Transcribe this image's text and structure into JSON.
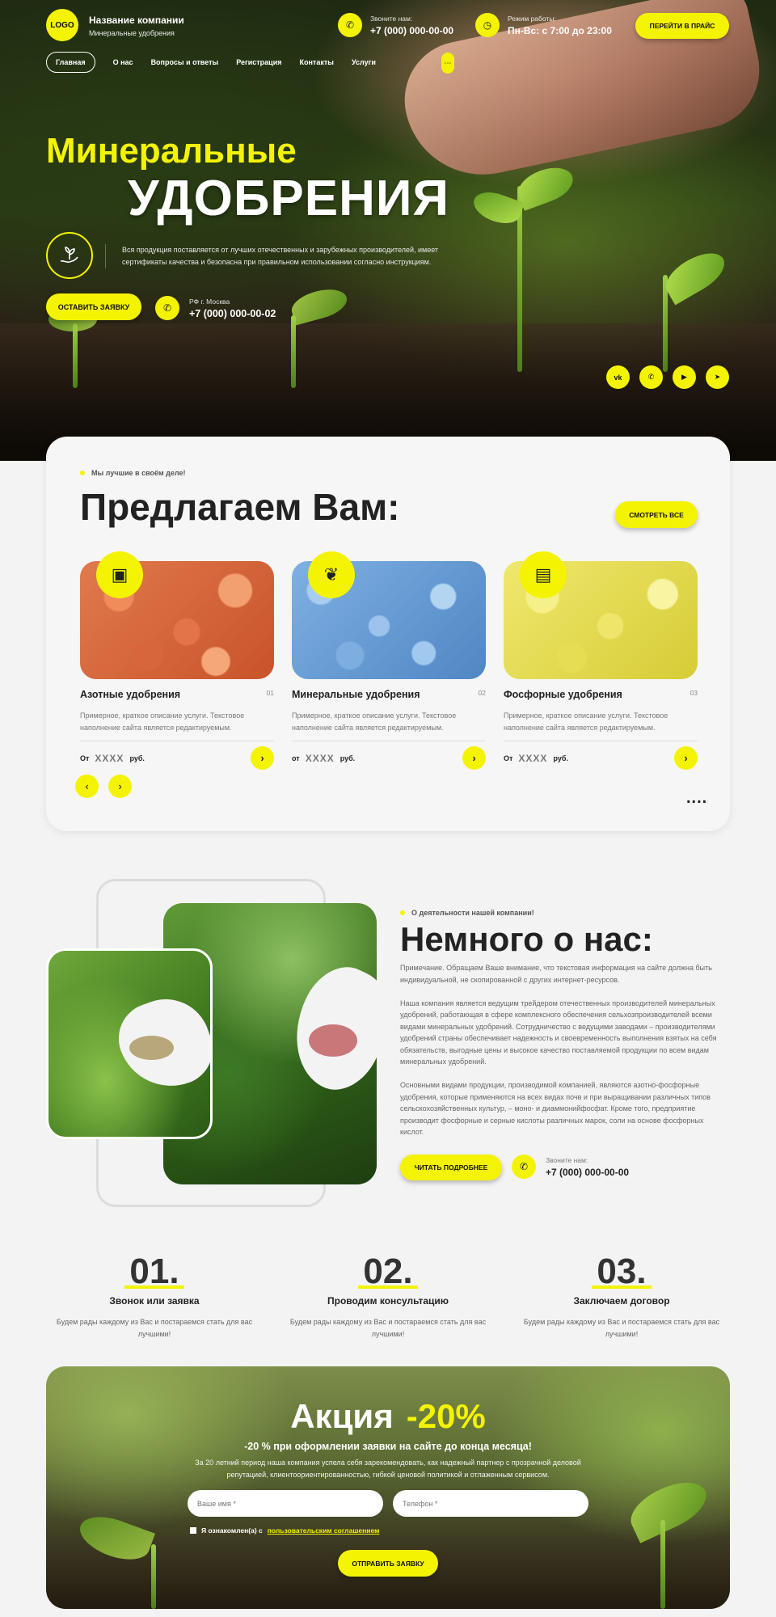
{
  "header": {
    "logo": "LOGO",
    "company_name": "Название компании",
    "company_sub": "Минеральные удобрения",
    "call_label": "Звоните нам:",
    "call_phone": "+7 (000) 000-00-00",
    "hours_label": "Режим работы:",
    "hours_value": "Пн-Вс: с 7:00 до 23:00",
    "price_button": "ПЕРЕЙТИ В ПРАЙС",
    "nav": [
      "Главная",
      "О нас",
      "Вопросы и ответы",
      "Регистрация",
      "Контакты",
      "Услуги"
    ]
  },
  "hero": {
    "title_line1": "Минеральные",
    "title_line2": "УДОБРЕНИЯ",
    "description": "Вся продукция поставляется от лучших отечественных и зарубежных производителей, имеет сертификаты качества и безопасна при правильном использовании согласно инструкциям.",
    "cta": "ОСТАВИТЬ ЗАЯВКУ",
    "city": "РФ г. Москва",
    "phone": "+7 (000) 000-00-02",
    "socials": [
      "vk",
      "wa",
      "yt",
      "tg"
    ]
  },
  "services": {
    "tag": "Мы лучшие в своём деле!",
    "title": "Предлагаем Вам:",
    "see_all": "СМОТРЕТЬ ВСЕ",
    "cards": [
      {
        "title": "Азотные удобрения",
        "num": "01",
        "desc": "Примерное, краткое описание услуги. Текстовое наполнение сайта является редактируемым.",
        "from": "От",
        "price": "XXXX",
        "unit": "руб."
      },
      {
        "title": "Минеральные удобрения",
        "num": "02",
        "desc": "Примерное, краткое описание услуги. Текстовое наполнение сайта является редактируемым.",
        "from": "от",
        "price": "XXXX",
        "unit": "руб."
      },
      {
        "title": "Фосфорные удобрения",
        "num": "03",
        "desc": "Примерное, краткое описание услуги. Текстовое наполнение сайта является редактируемым.",
        "from": "От",
        "price": "XXXX",
        "unit": "руб."
      }
    ],
    "more": "...."
  },
  "about": {
    "tag": "О деятельности нашей компании!",
    "title": "Немного о нас:",
    "p1": "Примечание. Обращаем Ваше внимание, что текстовая информация на сайте должна быть индивидуальной, не скопированной с других интернет-ресурсов.",
    "p2": "Наша компания является ведущим трейдером отечественных производителей минеральных удобрений, работающая в сфере комплексного обеспечения сельхозпроизводителей всеми видами минеральных удобрений. Сотрудничество с ведущими заводами – производителями удобрений страны обеспечивает надежность и своевременность выполнения взятых на себя обязательств, выгодные цены и высокое качество поставляемой продукции по всем видам минеральных удобрений.",
    "p3": "Основными видами продукции, производимой компанией, являются азотно-фосфорные удобрения, которые применяются на всех видах почв и при выращивании различных типов сельскохозяйственных культур, – моно- и диаммонийфосфат. Кроме того, предприятие производит фосфорные и серные кислоты различных марок, соли на основе фосфорных кислот.",
    "read_more": "ЧИТАТЬ ПОДРОБНЕЕ",
    "call_label": "Звоните нам:",
    "phone": "+7 (000) 000-00-00"
  },
  "steps": [
    {
      "num": "01.",
      "title": "Звонок или заявка",
      "desc": "Будем рады каждому из Вас и постараемся стать для вас лучшими!"
    },
    {
      "num": "02.",
      "title": "Проводим консультацию",
      "desc": "Будем рады каждому из Вас и постараемся стать для вас лучшими!"
    },
    {
      "num": "03.",
      "title": "Заключаем договор",
      "desc": "Будем рады каждому из Вас и постараемся стать для вас лучшими!"
    }
  ],
  "promo": {
    "title": "Акция",
    "discount": "-20%",
    "subtitle": "-20 % при оформлении заявки на сайте до конца месяца!",
    "desc": "За 20 летний период наша компания успела себя зарекомендовать, как надежный партнер с прозрачной деловой репутацией, клиентоориентированностью, гибкой ценовой политикой и отлаженным сервисом.",
    "name_placeholder": "Ваше имя *",
    "phone_placeholder": "Телефон *",
    "agree_text": "Я ознакомлен(а) с",
    "agree_link": "пользовательским соглашением",
    "submit": "ОТПРАВИТЬ ЗАЯВКУ"
  }
}
